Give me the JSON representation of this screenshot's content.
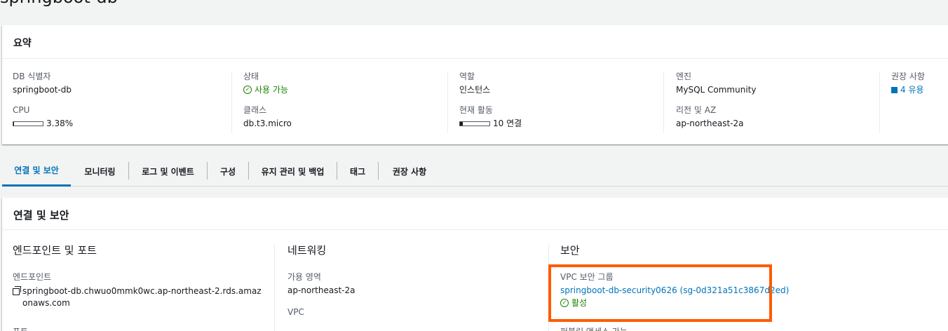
{
  "page": {
    "title": "springboot-db"
  },
  "summary": {
    "title": "요약",
    "columns": [
      {
        "label1": "DB 식별자",
        "value1": "springboot-db",
        "label2": "CPU",
        "value2": "3.38%",
        "meter_fraction": 0.0338
      },
      {
        "label1": "상태",
        "value1": "사용 가능",
        "label2": "클래스",
        "value2": "db.t3.micro"
      },
      {
        "label1": "역할",
        "value1": "인스턴스",
        "label2": "현재 활동",
        "value2": "10 연결",
        "meter_fraction": 0.1
      },
      {
        "label1": "엔진",
        "value1": "MySQL Community",
        "label2": "리전 및 AZ",
        "value2": "ap-northeast-2a"
      },
      {
        "label1": "권장 사항",
        "value1": "4 유용"
      }
    ]
  },
  "tabs": [
    "연결 및 보안",
    "모니터링",
    "로그 및 이벤트",
    "구성",
    "유지 관리 및 백업",
    "태그",
    "권장 사항"
  ],
  "connectivity": {
    "title": "연결 및 보안",
    "endpoint_section": {
      "title": "엔드포인트 및 포트",
      "endpoint_label": "엔드포인트",
      "endpoint_value": "springboot-db.chwuo0mmk0wc.ap-northeast-2.rds.amazonaws.com",
      "port_label": "포트"
    },
    "network_section": {
      "title": "네트워킹",
      "az_label": "가용 영역",
      "az_value": "ap-northeast-2a",
      "vpc_label": "VPC"
    },
    "security_section": {
      "title": "보안",
      "sg_label": "VPC 보안 그룹",
      "sg_value": "springboot-db-security0626 (sg-0d321a51c3867d2ed)",
      "sg_status": "활성",
      "public_label": "퍼블릭 액세스 가능"
    }
  },
  "colors": {
    "accent": "#0073bb",
    "success": "#1d8102",
    "highlight": "#ff5b00"
  }
}
